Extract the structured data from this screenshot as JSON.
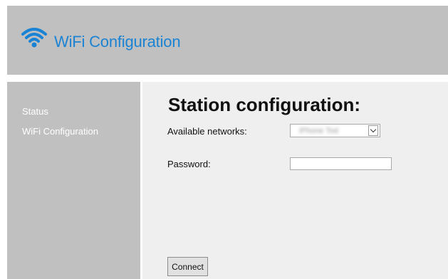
{
  "header": {
    "title": "WiFi Configuration",
    "icon": "wifi-icon",
    "accent_color": "#1a83d4",
    "background_color": "#c0c0c0"
  },
  "sidebar": {
    "items": [
      {
        "label": "Status"
      },
      {
        "label": "WiFi Configuration"
      }
    ]
  },
  "main": {
    "title": "Station configuration:",
    "networks_label": "Available networks:",
    "selected_network": "iPhone Tod",
    "password_label": "Password:",
    "password_value": "",
    "connect_label": "Connect"
  }
}
